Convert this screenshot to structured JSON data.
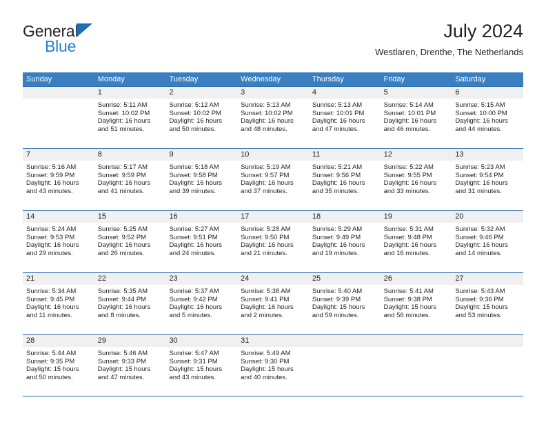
{
  "brand": {
    "name_part1": "General",
    "name_part2": "Blue",
    "accent_color": "#1f7fd1",
    "triangle_color": "#1f6fb5"
  },
  "header": {
    "title": "July 2024",
    "subtitle": "Westlaren, Drenthe, The Netherlands"
  },
  "calendar": {
    "header_bg": "#3a7fc1",
    "header_text_color": "#ffffff",
    "row_divider_color": "#2f6fae",
    "day_band_bg": "#f0f0f0",
    "weekdays": [
      "Sunday",
      "Monday",
      "Tuesday",
      "Wednesday",
      "Thursday",
      "Friday",
      "Saturday"
    ],
    "weeks": [
      [
        {
          "day": "",
          "sunrise": "",
          "sunset": "",
          "daylight_line1": "",
          "daylight_line2": ""
        },
        {
          "day": "1",
          "sunrise": "Sunrise: 5:11 AM",
          "sunset": "Sunset: 10:02 PM",
          "daylight_line1": "Daylight: 16 hours",
          "daylight_line2": "and 51 minutes."
        },
        {
          "day": "2",
          "sunrise": "Sunrise: 5:12 AM",
          "sunset": "Sunset: 10:02 PM",
          "daylight_line1": "Daylight: 16 hours",
          "daylight_line2": "and 50 minutes."
        },
        {
          "day": "3",
          "sunrise": "Sunrise: 5:13 AM",
          "sunset": "Sunset: 10:02 PM",
          "daylight_line1": "Daylight: 16 hours",
          "daylight_line2": "and 48 minutes."
        },
        {
          "day": "4",
          "sunrise": "Sunrise: 5:13 AM",
          "sunset": "Sunset: 10:01 PM",
          "daylight_line1": "Daylight: 16 hours",
          "daylight_line2": "and 47 minutes."
        },
        {
          "day": "5",
          "sunrise": "Sunrise: 5:14 AM",
          "sunset": "Sunset: 10:01 PM",
          "daylight_line1": "Daylight: 16 hours",
          "daylight_line2": "and 46 minutes."
        },
        {
          "day": "6",
          "sunrise": "Sunrise: 5:15 AM",
          "sunset": "Sunset: 10:00 PM",
          "daylight_line1": "Daylight: 16 hours",
          "daylight_line2": "and 44 minutes."
        }
      ],
      [
        {
          "day": "7",
          "sunrise": "Sunrise: 5:16 AM",
          "sunset": "Sunset: 9:59 PM",
          "daylight_line1": "Daylight: 16 hours",
          "daylight_line2": "and 43 minutes."
        },
        {
          "day": "8",
          "sunrise": "Sunrise: 5:17 AM",
          "sunset": "Sunset: 9:59 PM",
          "daylight_line1": "Daylight: 16 hours",
          "daylight_line2": "and 41 minutes."
        },
        {
          "day": "9",
          "sunrise": "Sunrise: 5:18 AM",
          "sunset": "Sunset: 9:58 PM",
          "daylight_line1": "Daylight: 16 hours",
          "daylight_line2": "and 39 minutes."
        },
        {
          "day": "10",
          "sunrise": "Sunrise: 5:19 AM",
          "sunset": "Sunset: 9:57 PM",
          "daylight_line1": "Daylight: 16 hours",
          "daylight_line2": "and 37 minutes."
        },
        {
          "day": "11",
          "sunrise": "Sunrise: 5:21 AM",
          "sunset": "Sunset: 9:56 PM",
          "daylight_line1": "Daylight: 16 hours",
          "daylight_line2": "and 35 minutes."
        },
        {
          "day": "12",
          "sunrise": "Sunrise: 5:22 AM",
          "sunset": "Sunset: 9:55 PM",
          "daylight_line1": "Daylight: 16 hours",
          "daylight_line2": "and 33 minutes."
        },
        {
          "day": "13",
          "sunrise": "Sunrise: 5:23 AM",
          "sunset": "Sunset: 9:54 PM",
          "daylight_line1": "Daylight: 16 hours",
          "daylight_line2": "and 31 minutes."
        }
      ],
      [
        {
          "day": "14",
          "sunrise": "Sunrise: 5:24 AM",
          "sunset": "Sunset: 9:53 PM",
          "daylight_line1": "Daylight: 16 hours",
          "daylight_line2": "and 29 minutes."
        },
        {
          "day": "15",
          "sunrise": "Sunrise: 5:25 AM",
          "sunset": "Sunset: 9:52 PM",
          "daylight_line1": "Daylight: 16 hours",
          "daylight_line2": "and 26 minutes."
        },
        {
          "day": "16",
          "sunrise": "Sunrise: 5:27 AM",
          "sunset": "Sunset: 9:51 PM",
          "daylight_line1": "Daylight: 16 hours",
          "daylight_line2": "and 24 minutes."
        },
        {
          "day": "17",
          "sunrise": "Sunrise: 5:28 AM",
          "sunset": "Sunset: 9:50 PM",
          "daylight_line1": "Daylight: 16 hours",
          "daylight_line2": "and 21 minutes."
        },
        {
          "day": "18",
          "sunrise": "Sunrise: 5:29 AM",
          "sunset": "Sunset: 9:49 PM",
          "daylight_line1": "Daylight: 16 hours",
          "daylight_line2": "and 19 minutes."
        },
        {
          "day": "19",
          "sunrise": "Sunrise: 5:31 AM",
          "sunset": "Sunset: 9:48 PM",
          "daylight_line1": "Daylight: 16 hours",
          "daylight_line2": "and 16 minutes."
        },
        {
          "day": "20",
          "sunrise": "Sunrise: 5:32 AM",
          "sunset": "Sunset: 9:46 PM",
          "daylight_line1": "Daylight: 16 hours",
          "daylight_line2": "and 14 minutes."
        }
      ],
      [
        {
          "day": "21",
          "sunrise": "Sunrise: 5:34 AM",
          "sunset": "Sunset: 9:45 PM",
          "daylight_line1": "Daylight: 16 hours",
          "daylight_line2": "and 11 minutes."
        },
        {
          "day": "22",
          "sunrise": "Sunrise: 5:35 AM",
          "sunset": "Sunset: 9:44 PM",
          "daylight_line1": "Daylight: 16 hours",
          "daylight_line2": "and 8 minutes."
        },
        {
          "day": "23",
          "sunrise": "Sunrise: 5:37 AM",
          "sunset": "Sunset: 9:42 PM",
          "daylight_line1": "Daylight: 16 hours",
          "daylight_line2": "and 5 minutes."
        },
        {
          "day": "24",
          "sunrise": "Sunrise: 5:38 AM",
          "sunset": "Sunset: 9:41 PM",
          "daylight_line1": "Daylight: 16 hours",
          "daylight_line2": "and 2 minutes."
        },
        {
          "day": "25",
          "sunrise": "Sunrise: 5:40 AM",
          "sunset": "Sunset: 9:39 PM",
          "daylight_line1": "Daylight: 15 hours",
          "daylight_line2": "and 59 minutes."
        },
        {
          "day": "26",
          "sunrise": "Sunrise: 5:41 AM",
          "sunset": "Sunset: 9:38 PM",
          "daylight_line1": "Daylight: 15 hours",
          "daylight_line2": "and 56 minutes."
        },
        {
          "day": "27",
          "sunrise": "Sunrise: 5:43 AM",
          "sunset": "Sunset: 9:36 PM",
          "daylight_line1": "Daylight: 15 hours",
          "daylight_line2": "and 53 minutes."
        }
      ],
      [
        {
          "day": "28",
          "sunrise": "Sunrise: 5:44 AM",
          "sunset": "Sunset: 9:35 PM",
          "daylight_line1": "Daylight: 15 hours",
          "daylight_line2": "and 50 minutes."
        },
        {
          "day": "29",
          "sunrise": "Sunrise: 5:46 AM",
          "sunset": "Sunset: 9:33 PM",
          "daylight_line1": "Daylight: 15 hours",
          "daylight_line2": "and 47 minutes."
        },
        {
          "day": "30",
          "sunrise": "Sunrise: 5:47 AM",
          "sunset": "Sunset: 9:31 PM",
          "daylight_line1": "Daylight: 15 hours",
          "daylight_line2": "and 43 minutes."
        },
        {
          "day": "31",
          "sunrise": "Sunrise: 5:49 AM",
          "sunset": "Sunset: 9:30 PM",
          "daylight_line1": "Daylight: 15 hours",
          "daylight_line2": "and 40 minutes."
        },
        {
          "day": "",
          "sunrise": "",
          "sunset": "",
          "daylight_line1": "",
          "daylight_line2": ""
        },
        {
          "day": "",
          "sunrise": "",
          "sunset": "",
          "daylight_line1": "",
          "daylight_line2": ""
        },
        {
          "day": "",
          "sunrise": "",
          "sunset": "",
          "daylight_line1": "",
          "daylight_line2": ""
        }
      ]
    ]
  }
}
